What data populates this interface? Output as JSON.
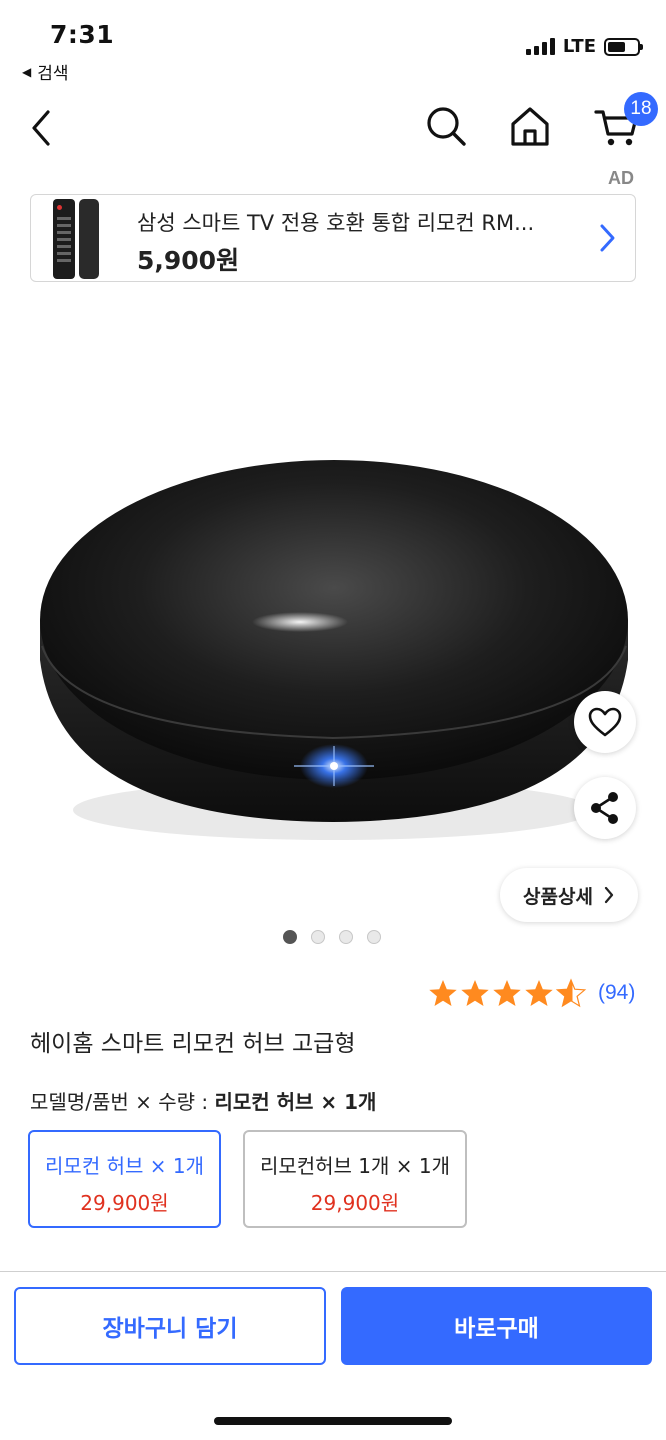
{
  "status_bar": {
    "time": "7:31",
    "back_app_label": "검색",
    "network": "LTE"
  },
  "nav": {
    "cart_count": "18",
    "icons": [
      "back-icon",
      "search-icon",
      "home-icon",
      "cart-icon"
    ]
  },
  "ad": {
    "tag": "AD",
    "title": "삼성 스마트 TV 전용 호환 통합 리모컨 RM...",
    "price": "5,900원"
  },
  "gallery": {
    "detail_label": "상품상세",
    "image_count": 4,
    "active_index": 0
  },
  "rating": {
    "stars": 4.5,
    "count": "(94)",
    "color": "#ff8a1f"
  },
  "product": {
    "title": "헤이홈 스마트 리모컨 허브 고급형"
  },
  "options": {
    "label_prefix": "모델명/품번 × 수량 : ",
    "label_value": "리모컨 허브 × 1개",
    "items": [
      {
        "name": "리모컨 허브 × 1개",
        "price": "29,900원",
        "selected": true
      },
      {
        "name": "리모컨허브 1개 × 1개",
        "price": "29,900원",
        "selected": false
      }
    ]
  },
  "actions": {
    "add_to_cart": "장바구니 담기",
    "buy_now": "바로구매"
  },
  "colors": {
    "accent": "#346aff",
    "price_red": "#e0311f"
  }
}
